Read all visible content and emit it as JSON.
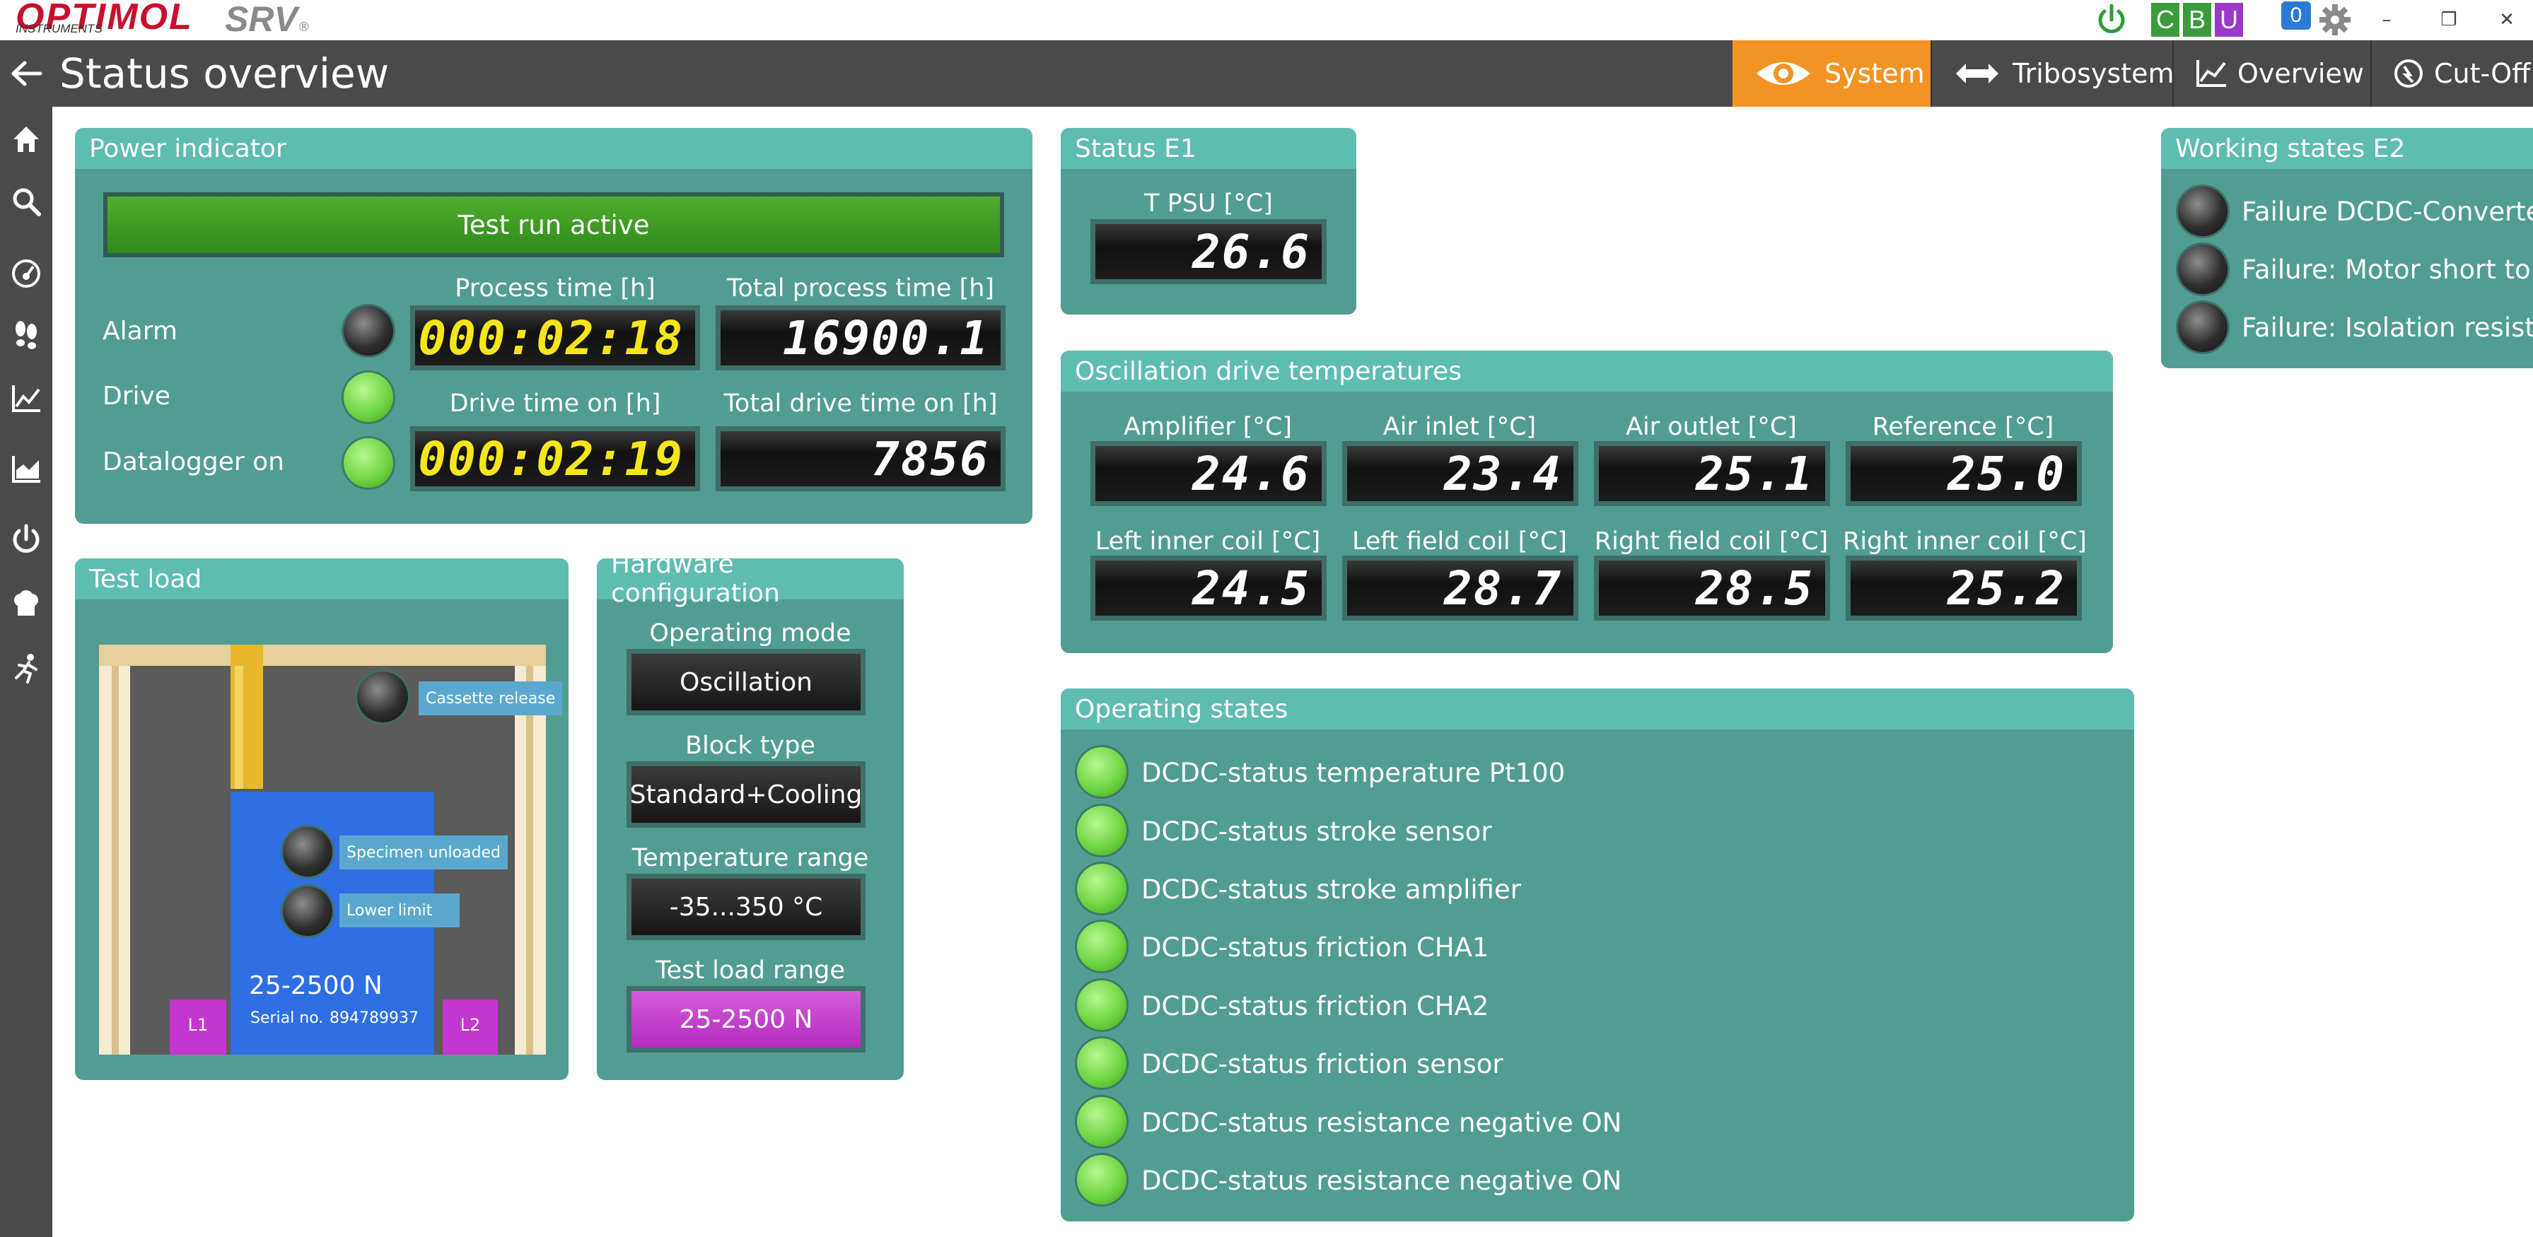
{
  "titlebar": {
    "brand": "OPTIMOL",
    "brand_sub": "INSTRUMENTS",
    "product": "SRV",
    "product_mark": "®",
    "cbu": [
      "C",
      "B",
      "U"
    ],
    "notifications": "0",
    "colors": {
      "power": "#2e9c3a",
      "c": "#3a9c3a",
      "b": "#3a9c3a",
      "u": "#9c38c9",
      "notif": "#2a7bd6"
    }
  },
  "header": {
    "title": "Status overview",
    "nav": [
      {
        "label": "System",
        "icon": "eye-icon",
        "active": true
      },
      {
        "label": "Tribosystem",
        "icon": "double-arrow-icon",
        "active": false
      },
      {
        "label": "Overview",
        "icon": "chart-icon",
        "active": false
      },
      {
        "label": "Cut-Off",
        "icon": "cutoff-icon",
        "active": false
      }
    ],
    "active_color": "#f39324"
  },
  "sidebar": [
    "home-icon",
    "search-icon",
    "gauge-icon",
    "footprints-icon",
    "line-chart-icon",
    "area-chart-icon",
    "power-icon",
    "chef-hat-icon",
    "running-person-icon"
  ],
  "power_indicator": {
    "title": "Power indicator",
    "banner": "Test run active",
    "indicators": [
      {
        "label": "Alarm",
        "state": "off"
      },
      {
        "label": "Drive",
        "state": "on"
      },
      {
        "label": "Datalogger on",
        "state": "on"
      }
    ],
    "process_time_label": "Process time [h]",
    "process_time": "000:02:18",
    "total_process_time_label": "Total process time [h]",
    "total_process_time": "16900.1",
    "drive_time_label": "Drive time on [h]",
    "drive_time": "000:02:19",
    "total_drive_time_label": "Total drive time on [h]",
    "total_drive_time": "7856"
  },
  "status_e1": {
    "title": "Status E1",
    "t_psu_label": "T PSU [°C]",
    "t_psu": "26.6"
  },
  "working_states_e2": {
    "title": "Working states E2",
    "items": [
      {
        "label": "Failure DCDC-Converter",
        "state": "off"
      },
      {
        "label": "Failure: Motor short to gr",
        "state": "off"
      },
      {
        "label": "Failure: Isolation resistanc",
        "state": "off"
      }
    ]
  },
  "oscillation": {
    "title": "Oscillation drive temperatures",
    "cells": [
      {
        "label": "Amplifier [°C]",
        "value": "24.6"
      },
      {
        "label": "Air inlet [°C]",
        "value": "23.4"
      },
      {
        "label": "Air outlet [°C]",
        "value": "25.1"
      },
      {
        "label": "Reference [°C]",
        "value": "25.0"
      },
      {
        "label": "Left inner coil [°C]",
        "value": "24.5"
      },
      {
        "label": "Left field coil [°C]",
        "value": "28.7"
      },
      {
        "label": "Right field coil [°C]",
        "value": "28.5"
      },
      {
        "label": "Right inner coil [°C]",
        "value": "25.2"
      }
    ]
  },
  "test_load": {
    "title": "Test load",
    "cassette_release": "Cassette release",
    "specimen_unloaded": "Specimen unloaded",
    "lower_limit": "Lower limit",
    "range": "25-2500 N",
    "serial_label": "Serial no.",
    "serial": "894789937",
    "l1": "L1",
    "l2": "L2"
  },
  "hardware": {
    "title": "Hardware configuration",
    "operating_mode_label": "Operating mode",
    "operating_mode": "Oscillation",
    "block_type_label": "Block type",
    "block_type": "Standard+Cooling",
    "temp_range_label": "Temperature range",
    "temp_range": "-35...350 °C",
    "test_load_range_label": "Test load range",
    "test_load_range": "25-2500 N"
  },
  "operating_states": {
    "title": "Operating states",
    "items": [
      {
        "label": "DCDC-status temperature Pt100",
        "state": "on"
      },
      {
        "label": "DCDC-status stroke sensor",
        "state": "on"
      },
      {
        "label": "DCDC-status stroke amplifier",
        "state": "on"
      },
      {
        "label": "DCDC-status friction CHA1",
        "state": "on"
      },
      {
        "label": "DCDC-status friction CHA2",
        "state": "on"
      },
      {
        "label": "DCDC-status friction sensor",
        "state": "on"
      },
      {
        "label": "DCDC-status resistance negative ON",
        "state": "on"
      },
      {
        "label": "DCDC-status resistance negative ON",
        "state": "on"
      }
    ]
  }
}
